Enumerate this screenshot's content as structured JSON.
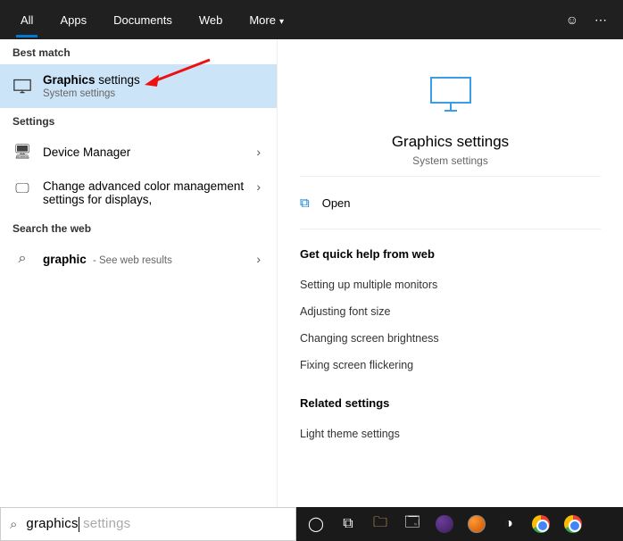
{
  "tabs": [
    "All",
    "Apps",
    "Documents",
    "Web",
    "More"
  ],
  "left": {
    "bestMatchLabel": "Best match",
    "bestMatch": {
      "title_bold": "Graphics",
      "title_rest": " settings",
      "sub": "System settings"
    },
    "settingsLabel": "Settings",
    "settingsItems": [
      {
        "title": "Device Manager"
      },
      {
        "title": "Change advanced color management settings for displays,"
      }
    ],
    "webLabel": "Search the web",
    "webItem": {
      "title_bold": "graphic",
      "sub": "See web results"
    }
  },
  "right": {
    "title": "Graphics settings",
    "sub": "System settings",
    "open": "Open",
    "quickHead": "Get quick help from web",
    "quickLinks": [
      "Setting up multiple monitors",
      "Adjusting font size",
      "Changing screen brightness",
      "Fixing screen flickering"
    ],
    "relatedHead": "Related settings",
    "relatedLinks": [
      "Light theme settings"
    ]
  },
  "search": {
    "typed": "graphics",
    "ghost": " settings"
  }
}
